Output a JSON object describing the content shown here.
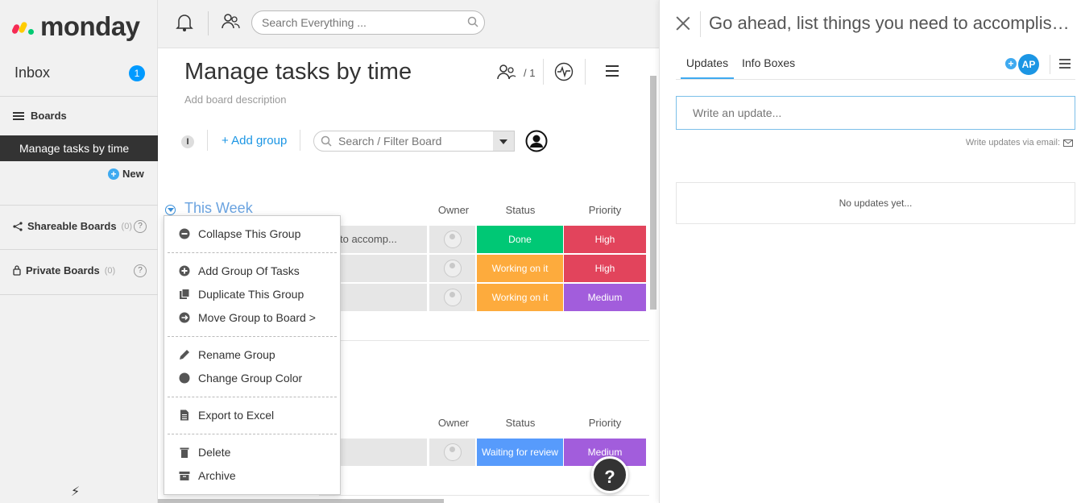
{
  "app": {
    "logo_text": "monday"
  },
  "sidebar": {
    "inbox_label": "Inbox",
    "inbox_count": "1",
    "boards_label": "Boards",
    "active_board": "Manage tasks by time",
    "new_label": "New",
    "shareable": {
      "label": "Shareable Boards",
      "count": "(0)",
      "help": "?"
    },
    "private": {
      "label": "Private Boards",
      "count": "(0)",
      "help": "?"
    }
  },
  "topbar": {
    "search_placeholder": "Search Everything ..."
  },
  "board": {
    "title": "Manage tasks by time",
    "description": "Add board description",
    "subscribers": "/ 1",
    "info_badge": "I",
    "add_group": "+ Add group",
    "filter_placeholder": "Search / Filter Board",
    "help": "?"
  },
  "groups": [
    {
      "title": "This Week",
      "columns": {
        "owner": "Owner",
        "status": "Status",
        "priority": "Priority"
      },
      "rows": [
        {
          "name": "to accomp...",
          "status": "Done",
          "priority": "High"
        },
        {
          "name": "",
          "status": "Working on it",
          "priority": "High"
        },
        {
          "name": "",
          "status": "Working on it",
          "priority": "Medium"
        }
      ]
    },
    {
      "title": "",
      "columns": {
        "owner": "Owner",
        "status": "Status",
        "priority": "Priority"
      },
      "rows": [
        {
          "name": "",
          "status": "Waiting for review",
          "priority": "Medium"
        }
      ]
    }
  ],
  "colors": {
    "done": "#00c875",
    "working": "#fdab3d",
    "waiting": "#579bfc",
    "high": "#e2445c",
    "medium": "#a25ddc",
    "accent": "#1c96e4"
  },
  "context_menu": {
    "collapse": "Collapse This Group",
    "add_group": "Add Group Of Tasks",
    "duplicate": "Duplicate This Group",
    "move": "Move Group to Board >",
    "rename": "Rename Group",
    "color": "Change Group Color",
    "export": "Export to Excel",
    "delete": "Delete",
    "archive": "Archive"
  },
  "panel": {
    "title": "Go ahead, list things you need to accomplish t...",
    "tabs": [
      "Updates",
      "Info Boxes"
    ],
    "avatar": "AP",
    "update_placeholder": "Write an update...",
    "via_email": "Write updates via email:",
    "empty": "No updates yet..."
  }
}
